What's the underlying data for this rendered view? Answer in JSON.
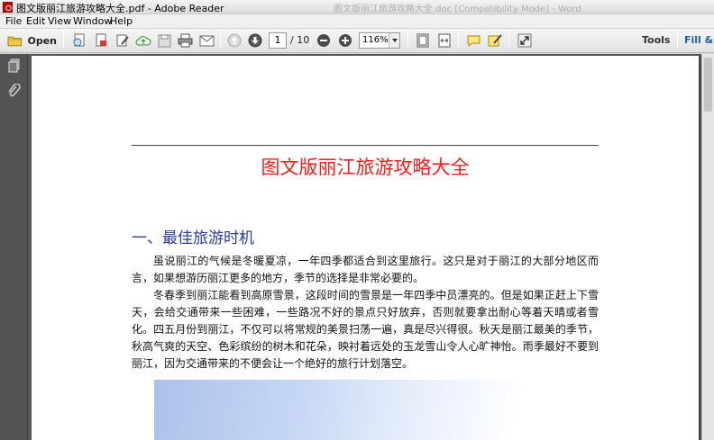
{
  "window": {
    "title": "图文版丽江旅游攻略大全.pdf - Adobe Reader",
    "ghost_title": "图文版丽江旅游攻略大全.doc [Compatibility Mode] - Word"
  },
  "menu": {
    "items": [
      "File",
      "Edit",
      "View",
      "Window",
      "Help"
    ]
  },
  "toolbar": {
    "open_label": "Open",
    "current_page": "1",
    "total_pages": "/ 10",
    "zoom": "116%",
    "tools_label": "Tools",
    "fill_sign_label": "Fill & S"
  },
  "document": {
    "title": "图文版丽江旅游攻略大全",
    "section_heading": "一、最佳旅游时机",
    "paragraphs": [
      "虽说丽江的气候是冬暖夏凉，一年四季都适合到这里旅行。这只是对于丽江的大部分地区而言，如果想游历丽江更多的地方，季节的选择是非常必要的。",
      "冬春季到丽江能看到高原雪景，这段时间的雪景是一年四季中员漂亮的。但是如果正赶上下雪天，会给交通带来一些困难，一些路况不好的景点只好放弃，否则就要拿出耐心等着天晴或者雪化。四五月份到丽江，不仅可以将常规的美景扫荡一遍，真是尽兴得很。秋天是丽江最美的季节，秋高气爽的天空、色彩缤纷的树木和花朵，映衬着远处的玉龙雪山令人心旷神怡。雨季最好不要到丽江，因为交通带来的不便会让一个绝好的旅行计划落空。"
    ]
  },
  "colors": {
    "title_red": "#ff1a1a",
    "heading_blue": "#2b3aa0",
    "nav_panel": "#535353",
    "link_blue": "#1a5fa8"
  }
}
